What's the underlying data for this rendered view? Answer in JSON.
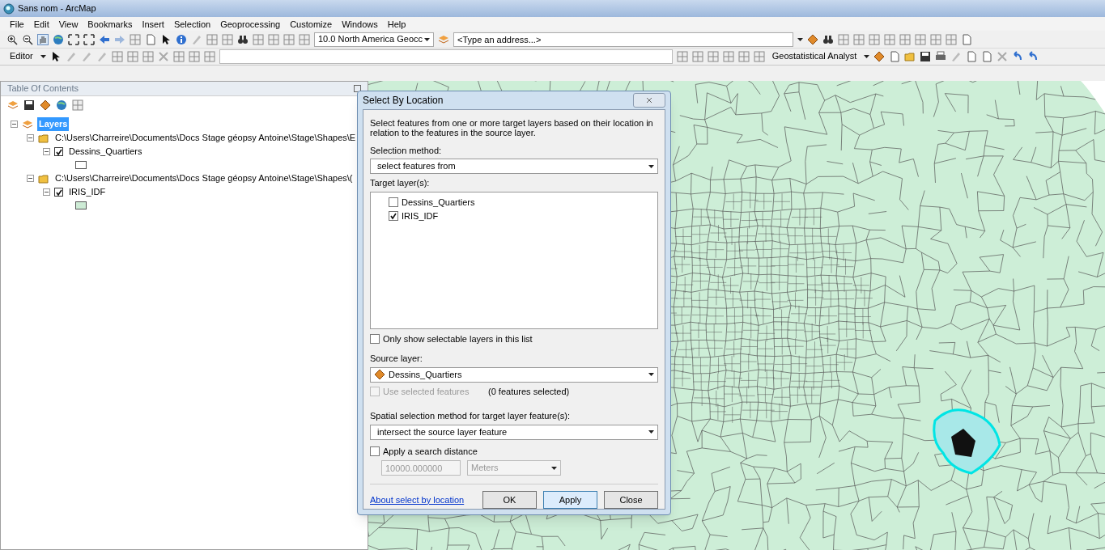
{
  "window": {
    "title": "Sans nom - ArcMap"
  },
  "menu": [
    "File",
    "Edit",
    "View",
    "Bookmarks",
    "Insert",
    "Selection",
    "Geoprocessing",
    "Customize",
    "Windows",
    "Help"
  ],
  "toolbar": {
    "coordinate_system": "10.0 North America Geocc",
    "address_placeholder": "<Type an address...>",
    "editor_label": "Editor",
    "geostatistical_label": "Geostatistical Analyst"
  },
  "toc": {
    "title": "Table Of Contents",
    "tree": [
      {
        "label": "Layers",
        "kind": "frame",
        "selected": true,
        "expanded": true,
        "children": [
          {
            "label": "C:\\Users\\Charreire\\Documents\\Docs Stage géopsy Antoine\\Stage\\Shapes\\E",
            "kind": "folder",
            "selected": false,
            "expanded": true,
            "children": [
              {
                "label": "Dessins_Quartiers",
                "kind": "layer",
                "selected": false,
                "expanded": true,
                "checked": true,
                "color": "#ffffff"
              }
            ]
          },
          {
            "label": "C:\\Users\\Charreire\\Documents\\Docs Stage géopsy Antoine\\Stage\\Shapes\\(",
            "kind": "folder",
            "selected": false,
            "expanded": true,
            "children": [
              {
                "label": "IRIS_IDF",
                "kind": "layer",
                "selected": false,
                "expanded": true,
                "checked": true,
                "color": "#cdebd5"
              }
            ]
          }
        ]
      }
    ]
  },
  "dialog": {
    "title": "Select By Location",
    "description": "Select features from one or more target layers based on their location in relation to the features in the source layer.",
    "selection_method_label": "Selection method:",
    "selection_method": "select features from",
    "target_label": "Target layer(s):",
    "targets": [
      {
        "label": "Dessins_Quartiers",
        "checked": false
      },
      {
        "label": "IRIS_IDF",
        "checked": true
      }
    ],
    "only_selectable": {
      "label": "Only show selectable layers in this list",
      "checked": false
    },
    "source_label": "Source layer:",
    "source_layer": "Dessins_Quartiers",
    "use_selected": {
      "label": "Use selected features",
      "checked": false,
      "disabled": true
    },
    "features_selected": "(0 features selected)",
    "spatial_label": "Spatial selection method for target layer feature(s):",
    "spatial_method": "intersect the source layer feature",
    "search_distance": {
      "label": "Apply a search distance",
      "checked": false
    },
    "distance_value": "10000.000000",
    "distance_unit": "Meters",
    "help_link": "About select by location",
    "buttons": [
      "OK",
      "Apply",
      "Close"
    ]
  }
}
